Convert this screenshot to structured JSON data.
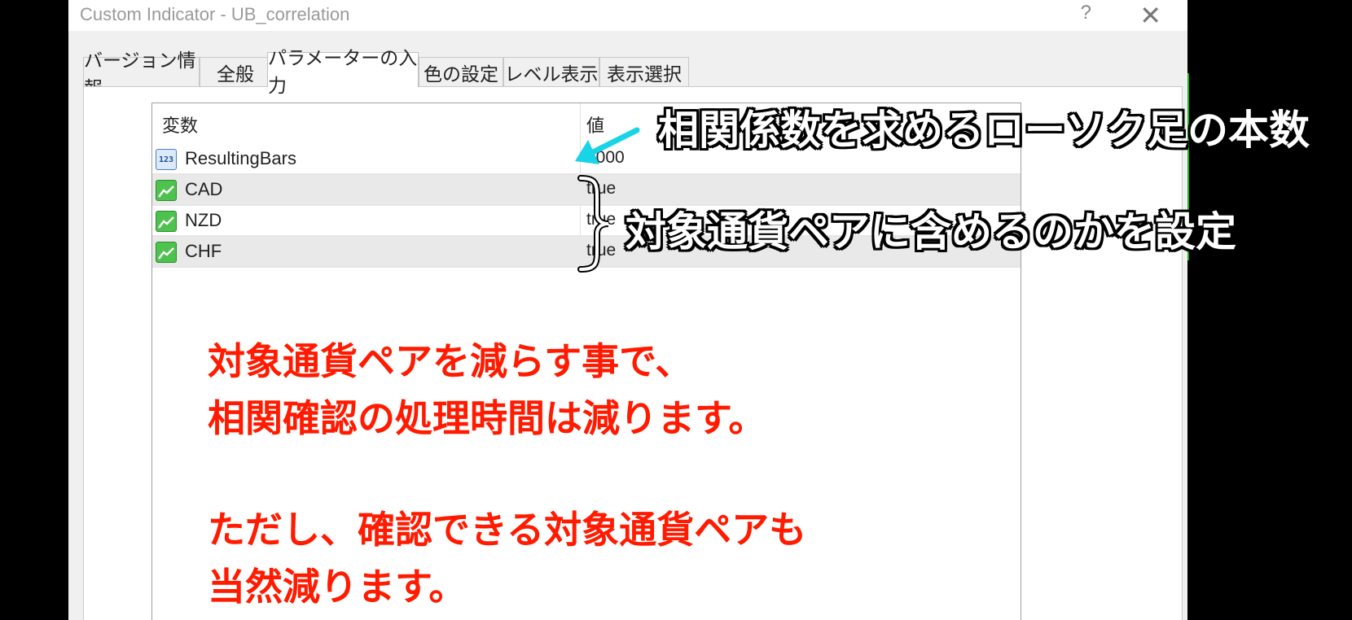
{
  "window": {
    "title": "Custom Indicator - UB_correlation",
    "help": "?",
    "close": "✕"
  },
  "tabs": [
    {
      "label": "バージョン情報"
    },
    {
      "label": "全般"
    },
    {
      "label": "パラメーターの入力",
      "active": true
    },
    {
      "label": "色の設定"
    },
    {
      "label": "レベル表示"
    },
    {
      "label": "表示選択"
    }
  ],
  "grid": {
    "headers": [
      "変数",
      "値"
    ],
    "rows": [
      {
        "icon": "number-icon",
        "icon_text": "123",
        "name": "ResultingBars",
        "value": "1000"
      },
      {
        "icon": "boolean-icon",
        "name": "CAD",
        "value": "true"
      },
      {
        "icon": "boolean-icon",
        "name": "NZD",
        "value": "true"
      },
      {
        "icon": "boolean-icon",
        "name": "CHF",
        "value": "true"
      }
    ]
  },
  "annotations": {
    "top": "相関係数を求めるローソク足の本数",
    "middle": "対象通貨ペアに含めるのかを設定",
    "red_lines": [
      "対象通貨ペアを減らす事で、",
      "相関確認の処理時間は減ります。",
      "ただし、確認できる対象通貨ペアも",
      "当然減ります。"
    ],
    "arrow_color": "#19d3e6",
    "red_color": "#ff1a00"
  }
}
